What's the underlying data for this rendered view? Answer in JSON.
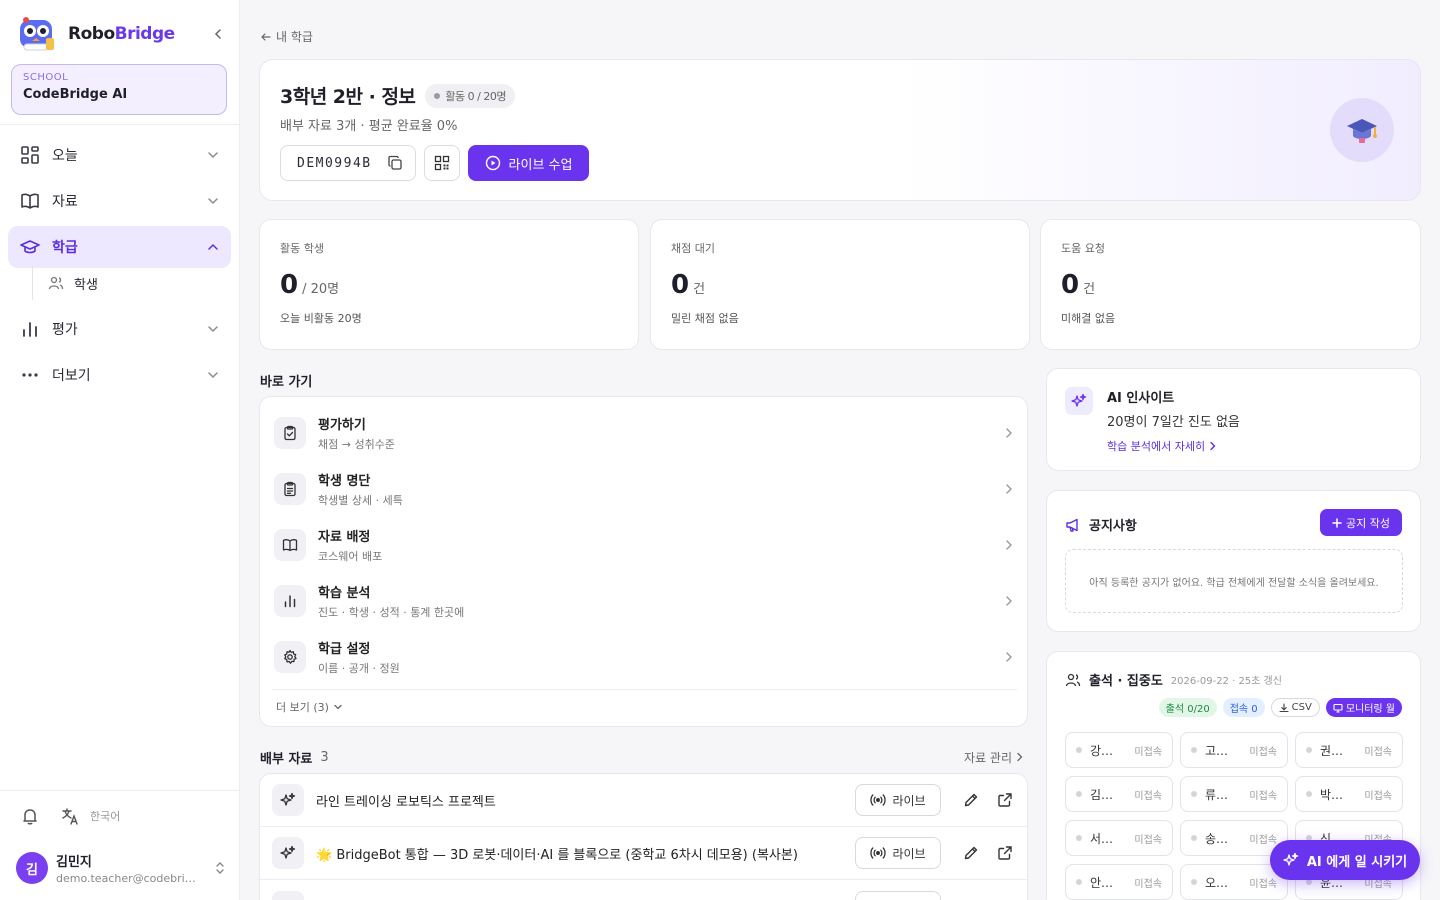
{
  "brand": {
    "name_a": "Robo",
    "name_b": "Bridge"
  },
  "school": {
    "label": "SCHOOL",
    "name": "CodeBridge AI"
  },
  "nav": {
    "today": "오늘",
    "materials": "자료",
    "class": "학급",
    "students": "학생",
    "assessment": "평가",
    "more": "더보기"
  },
  "sidebar_bottom": {
    "language": "한국어"
  },
  "user": {
    "initial": "김",
    "name": "김민지",
    "email": "demo.teacher@codebridge.ai"
  },
  "breadcrumb": {
    "back": "내 학급"
  },
  "hero": {
    "title": "3학년 2반 · 정보",
    "badge": "활동 0 / 20명",
    "subtitle": "배부 자료 3개 · 평균 완료율 0%",
    "code": "DEM0994B",
    "live_label": "라이브 수업"
  },
  "stats": [
    {
      "label": "활동 학생",
      "value": "0",
      "unit": "/ 20명",
      "foot": "오늘 비활동 20명"
    },
    {
      "label": "채점 대기",
      "value": "0",
      "unit": "건",
      "foot": "밀린 채점 없음"
    },
    {
      "label": "도움 요청",
      "value": "0",
      "unit": "건",
      "foot": "미해결 없음"
    }
  ],
  "quick": {
    "title": "바로 가기",
    "items": [
      {
        "title": "평가하기",
        "sub": "채점 → 성취수준"
      },
      {
        "title": "학생 명단",
        "sub": "학생별 상세 · 세특"
      },
      {
        "title": "자료 배정",
        "sub": "코스웨어 배포"
      },
      {
        "title": "학습 분석",
        "sub": "진도 · 학생 · 성적 · 통계 한곳에"
      },
      {
        "title": "학급 설정",
        "sub": "이름 · 공개 · 정원"
      }
    ],
    "more": "더 보기 (3)"
  },
  "materials": {
    "title": "배부 자료",
    "count": "3",
    "manage": "자료 관리",
    "live_label": "라이브",
    "rows": [
      {
        "title": "라인 트레이싱 로보틱스 프로젝트"
      },
      {
        "title": "🌟 BridgeBot 통합 — 3D 로봇·데이터·AI 를 블록으로 (중학교 6차시 데모용) (복사본)"
      },
      {
        "title": ""
      }
    ]
  },
  "ai_insight": {
    "title": "AI 인사이트",
    "body": "20명이 7일간 진도 없음",
    "link": "학습 분석에서 자세히"
  },
  "notice": {
    "title": "공지사항",
    "button": "공지 작성",
    "empty": "아직 등록한 공지가 없어요. 학급 전체에게 전달할 소식을 올려보세요."
  },
  "attendance": {
    "title": "출석 · 집중도",
    "date": "2026-09-22 · 25초 갱신",
    "tag_attend": "출석 0/20",
    "tag_conn": "접속 0",
    "tag_csv": "CSV",
    "tag_monitor": "모니터링 월",
    "seats": [
      {
        "name": "강…",
        "status": "미접속"
      },
      {
        "name": "고…",
        "status": "미접속"
      },
      {
        "name": "권…",
        "status": "미접속"
      },
      {
        "name": "김…",
        "status": "미접속"
      },
      {
        "name": "류…",
        "status": "미접속"
      },
      {
        "name": "박…",
        "status": "미접속"
      },
      {
        "name": "서…",
        "status": "미접속"
      },
      {
        "name": "송…",
        "status": "미접속"
      },
      {
        "name": "신…",
        "status": "미접속"
      },
      {
        "name": "안…",
        "status": "미접속"
      },
      {
        "name": "오…",
        "status": "미접속"
      },
      {
        "name": "윤…",
        "status": "미접속"
      }
    ]
  },
  "fab": {
    "label": "AI 에게 일 시키기"
  },
  "colors": {
    "accent": "#6a34ee",
    "accent_soft": "#ede7ff"
  }
}
